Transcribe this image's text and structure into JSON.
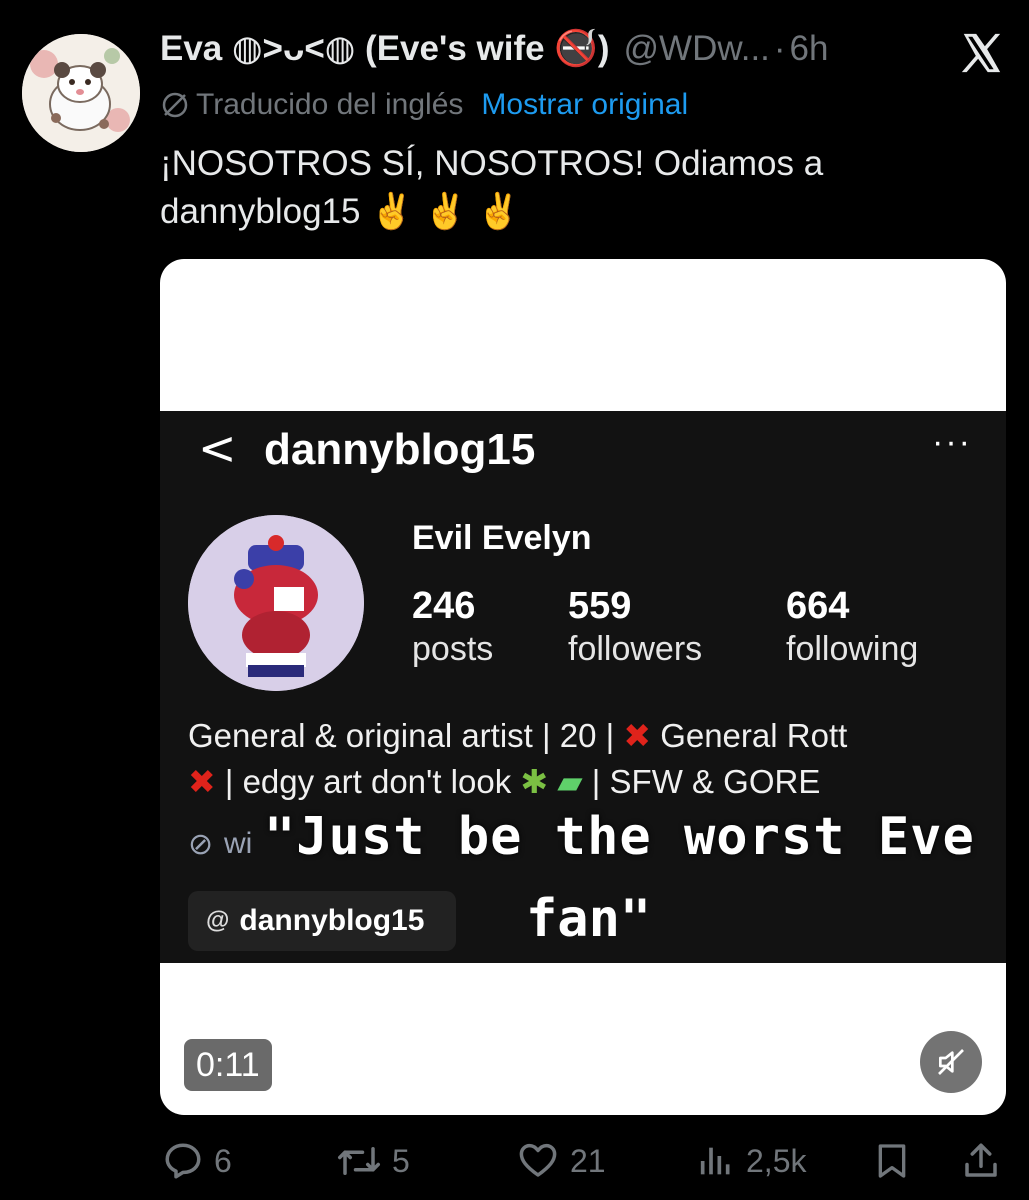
{
  "tweet": {
    "display_name": "Eva ◍˃ᴗ˂◍ (Eve's wife 🚭)",
    "handle": "@WDw...",
    "separator": "·",
    "time": "6h",
    "translation_note": "Traducido del inglés",
    "show_original": "Mostrar original",
    "text": "¡NOSOTROS SÍ, NOSOTROS! Odiamos a dannyblog15 ✌️ ✌️ ✌️"
  },
  "video": {
    "back_glyph": "<",
    "username": "dannyblog15",
    "more_glyph": "···",
    "display_name": "Evil Evelyn",
    "stats": [
      {
        "number": "246",
        "label": "posts"
      },
      {
        "number": "559",
        "label": "followers"
      },
      {
        "number": "664",
        "label": "following"
      }
    ],
    "bio_line1_a": "General & original artist | 20 |",
    "bio_line1_b": "General Rott",
    "bio_line2_a": "| edgy art don't look",
    "bio_line2_b": "| SFW & GORE",
    "link_fragment": "wi",
    "threads_handle": "dannyblog15",
    "caption_line1": "\"Just be the worst Eve",
    "caption_line2": "fan\"",
    "timer": "0:11"
  },
  "actions": {
    "replies": "6",
    "reposts": "5",
    "likes": "21",
    "views": "2,5k"
  },
  "colors": {
    "background": "#000000",
    "text": "#e7e9ea",
    "muted": "#71767b",
    "link": "#1d9bf0"
  },
  "icons": [
    "x-logo-icon",
    "translate-icon",
    "reply-icon",
    "repost-icon",
    "like-icon",
    "views-icon",
    "bookmark-icon",
    "share-icon",
    "mute-icon",
    "threads-icon",
    "link-icon"
  ]
}
